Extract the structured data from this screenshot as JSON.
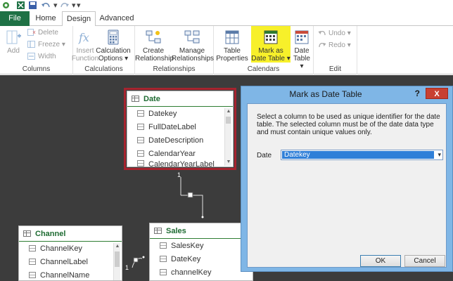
{
  "tabs": {
    "file": "File",
    "home": "Home",
    "design": "Design",
    "advanced": "Advanced"
  },
  "ribbon": {
    "columns": {
      "add": "Add",
      "delete": "Delete",
      "freeze": "Freeze",
      "width": "Width",
      "group": "Columns"
    },
    "calculations": {
      "insert_function": [
        "Insert",
        "Function"
      ],
      "calculation_options": [
        "Calculation",
        "Options"
      ],
      "group": "Calculations"
    },
    "relationships": {
      "create": [
        "Create",
        "Relationship"
      ],
      "manage": [
        "Manage",
        "Relationships"
      ],
      "group": "Relationships"
    },
    "calendars": {
      "table_properties": [
        "Table",
        "Properties"
      ],
      "mark_as_date_table": [
        "Mark as",
        "Date Table"
      ],
      "date_table": [
        "Date",
        "Table"
      ],
      "group": "Calendars"
    },
    "edit": {
      "undo": "Undo",
      "redo": "Redo",
      "group": "Edit"
    }
  },
  "diagram": {
    "date_table": {
      "name": "Date",
      "columns": [
        "Datekey",
        "FullDateLabel",
        "DateDescription",
        "CalendarYear",
        "CalendarYearLabel"
      ]
    },
    "channel_table": {
      "name": "Channel",
      "columns": [
        "ChannelKey",
        "ChannelLabel",
        "ChannelName"
      ]
    },
    "sales_table": {
      "name": "Sales",
      "columns": [
        "SalesKey",
        "DateKey",
        "channelKey"
      ]
    },
    "relationship_labels": {
      "one_date": "1",
      "one_channel": "1"
    }
  },
  "dialog": {
    "title": "Mark as Date Table",
    "help": "?",
    "close": "X",
    "description": "Select a column to be used as unique identifier for the date table. The selected column must be of the date data type and must contain unique values only.",
    "date_label": "Date",
    "selected_column": "Datekey",
    "ok": "OK",
    "cancel": "Cancel"
  },
  "colors": {
    "file_tab": "#1e7145",
    "highlight": "#f7f02a",
    "selection": "#a6242f",
    "dialog_frame": "#7fb6e6"
  }
}
